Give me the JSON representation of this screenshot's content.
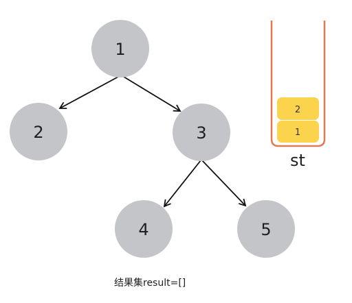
{
  "tree": {
    "nodes": [
      {
        "id": "1",
        "label": "1"
      },
      {
        "id": "2",
        "label": "2"
      },
      {
        "id": "3",
        "label": "3"
      },
      {
        "id": "4",
        "label": "4"
      },
      {
        "id": "5",
        "label": "5"
      }
    ],
    "edges": [
      {
        "from": "1",
        "to": "2"
      },
      {
        "from": "1",
        "to": "3"
      },
      {
        "from": "3",
        "to": "4"
      },
      {
        "from": "3",
        "to": "5"
      }
    ]
  },
  "stack": {
    "name": "st",
    "items": [
      "2",
      "1"
    ]
  },
  "result": {
    "text": "结果集result=[]"
  },
  "colors": {
    "node_fill": "#c3c5c9",
    "edge": "#111111",
    "stack_outline": "#e37a4f",
    "stack_item": "#fcd34d"
  }
}
